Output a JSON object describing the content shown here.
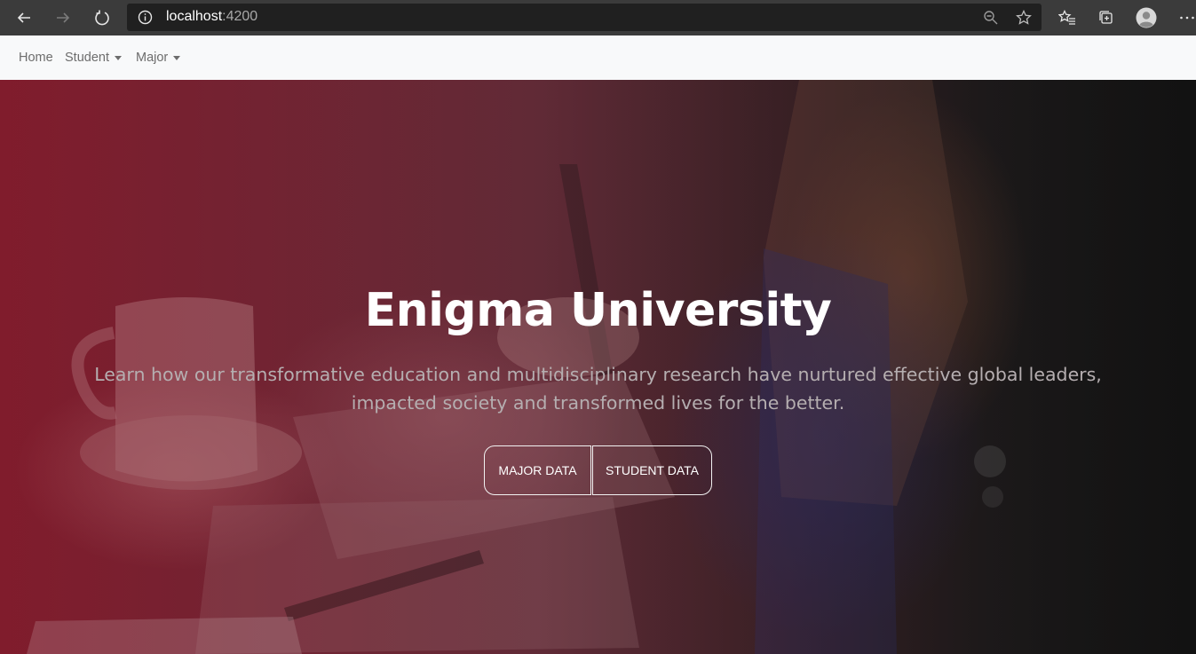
{
  "browser": {
    "url_host": "localhost",
    "url_port": ":4200",
    "icons": [
      "back-icon",
      "forward-icon",
      "refresh-icon",
      "info-icon",
      "zoom-icon",
      "favorite-star-icon",
      "favorites-list-icon",
      "collections-icon",
      "profile-avatar-icon",
      "more-icon"
    ]
  },
  "navbar": {
    "home": "Home",
    "student": "Student",
    "major": "Major"
  },
  "hero": {
    "title": "Enigma University",
    "subtitle_line1": "Learn how our transformative education and multidisciplinary research have nurtured effective global leaders,",
    "subtitle_line2": "impacted society and transformed lives for the better.",
    "buttons": {
      "major": "MAJOR DATA",
      "student": "STUDENT DATA"
    }
  },
  "colors": {
    "navbar_bg": "#f8f9fa",
    "nav_text": "#6d6d6d",
    "hero_accent": "#7a1e2c",
    "button_border": "#f2f2f2"
  }
}
